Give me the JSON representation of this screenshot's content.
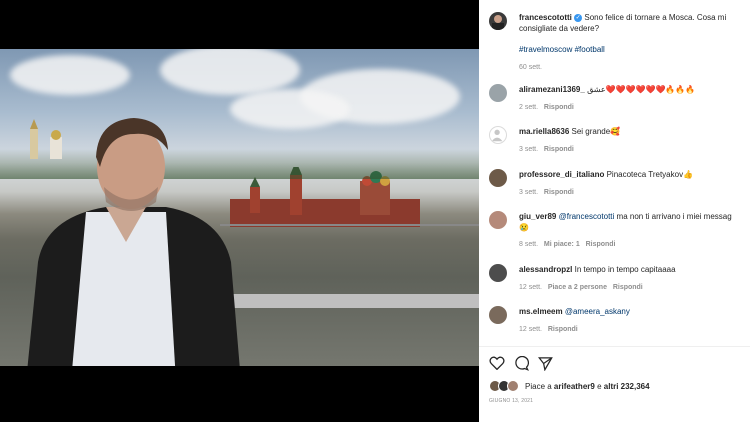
{
  "post": {
    "author": "francescototti",
    "verified": true,
    "caption": "Sono felice di tornare a Mosca. Cosa mi consigliate da vedere?",
    "hashtags": "#travelmoscow #football",
    "age": "60 sett."
  },
  "comments": [
    {
      "user": "aliramezani1369_",
      "text": "عشق❤️❤️❤️❤️❤️❤️🔥🔥🔥",
      "time": "2 sett.",
      "reply": "Rispondi",
      "likes": ""
    },
    {
      "user": "ma.riella8636",
      "text": "Sei grande🥰",
      "time": "3 sett.",
      "reply": "Rispondi",
      "likes": ""
    },
    {
      "user": "professore_di_italiano",
      "text": "Pinacoteca Tretyakov👍",
      "time": "3 sett.",
      "reply": "Rispondi",
      "likes": ""
    },
    {
      "user": "giu_ver89",
      "mention": "@francescototti",
      "text": "ma non ti arrivano i miei messag",
      "text2": "😢",
      "time": "8 sett.",
      "likes": "Mi piace: 1",
      "reply": "Rispondi"
    },
    {
      "user": "alessandropzl",
      "text": "In tempo in tempo capitaaaa",
      "time": "12 sett.",
      "likes": "Piace a 2 persone",
      "reply": "Rispondi"
    },
    {
      "user": "ms.elmeem",
      "mention": "@ameera_askany",
      "text": "",
      "time": "12 sett.",
      "reply": "Rispondi",
      "likes": ""
    }
  ],
  "likes": {
    "prefix": "Piace a",
    "user": "arifeather9",
    "middle": "e",
    "others": "altri 232,364"
  },
  "date": "GIUGNO 13, 2021",
  "icons": [
    "heart-icon",
    "comment-icon",
    "share-icon",
    "verified-icon"
  ]
}
